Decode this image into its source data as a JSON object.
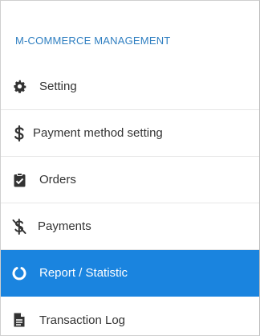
{
  "sidebar": {
    "section_title": "M-COMMERCE MANAGEMENT",
    "items": [
      {
        "label": "Setting",
        "icon": "gear-icon",
        "active": false
      },
      {
        "label": "Payment method setting",
        "icon": "dollar-icon",
        "active": false
      },
      {
        "label": "Orders",
        "icon": "clipboard-check-icon",
        "active": false
      },
      {
        "label": "Payments",
        "icon": "dollar-slash-icon",
        "active": false
      },
      {
        "label": "Report / Statistic",
        "icon": "circle-notch-icon",
        "active": true
      },
      {
        "label": "Transaction Log",
        "icon": "file-text-icon",
        "active": false
      }
    ]
  },
  "colors": {
    "accent": "#1a84df",
    "section_title": "#2f7fc1",
    "text": "#333333"
  }
}
